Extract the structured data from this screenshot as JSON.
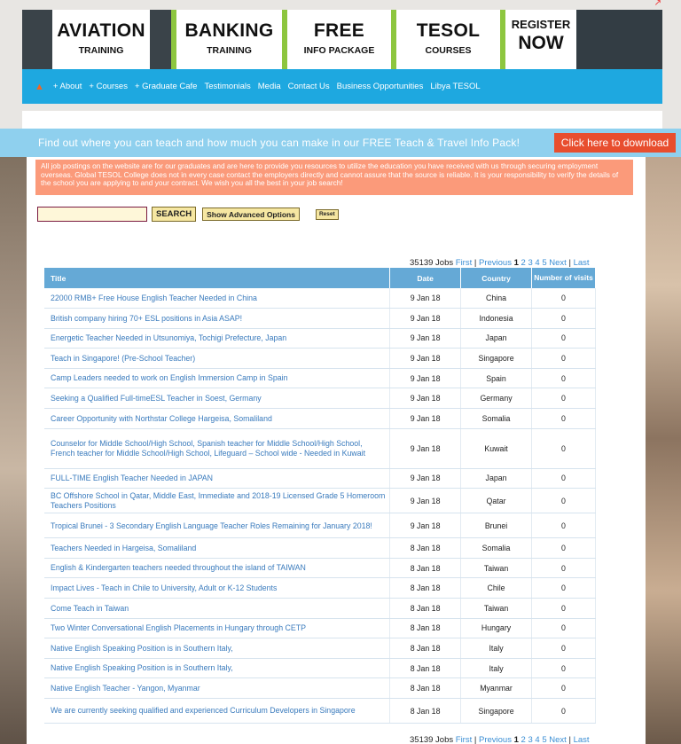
{
  "header": {
    "tiles": [
      {
        "big": "AVIATION",
        "small": "TRAINING"
      },
      {
        "big": "BANKING",
        "small": "TRAINING"
      },
      {
        "big": "FREE",
        "small": "INFO PACKAGE"
      },
      {
        "big": "TESOL",
        "small": "COURSES"
      }
    ],
    "register": {
      "line1": "REGISTER",
      "line2": "NOW"
    }
  },
  "nav": {
    "items": [
      "+ About",
      "+ Courses",
      "+ Graduate Cafe",
      "Testimonials",
      "Media",
      "Contact Us",
      "Business Opportunities",
      "Libya TESOL"
    ]
  },
  "promo": {
    "text": "Find out where you can teach and how much you can make in our FREE Teach & Travel Info Pack!",
    "button": "Click here to download"
  },
  "notice": "All job postings on the website are for our graduates and are here to provide you resources to utilize the education you have received with us through securing employment overseas. Global TESOL College does not in every case contact the employers directly and cannot assure that the source is reliable. It is your responsibility to verify the details of the school you are applying to and your contract. We wish you all the best in your job search!",
  "search": {
    "value": "",
    "search_label": "SEARCH",
    "advanced_label": "Show Advanced Options",
    "reset_label": "Reset"
  },
  "pager": {
    "count_text": "35139 Jobs",
    "first": "First",
    "previous": "Previous",
    "current": "1",
    "pages": [
      "2",
      "3",
      "4",
      "5"
    ],
    "next": "Next",
    "last": "Last",
    "sep": "|"
  },
  "table": {
    "headers": {
      "title": "Title",
      "date": "Date",
      "country": "Country",
      "visits": "Number of visits"
    },
    "rows": [
      {
        "title": "22000 RMB+ Free House English Teacher Needed in China",
        "date": "9 Jan 18",
        "country": "China",
        "visits": "0"
      },
      {
        "title": "British company hiring 70+ ESL positions in Asia ASAP!",
        "date": "9 Jan 18",
        "country": "Indonesia",
        "visits": "0"
      },
      {
        "title": "Energetic Teacher Needed in Utsunomiya, Tochigi Prefecture, Japan",
        "date": "9 Jan 18",
        "country": "Japan",
        "visits": "0"
      },
      {
        "title": "Teach in Singapore! (Pre-School Teacher)",
        "date": "9 Jan 18",
        "country": "Singapore",
        "visits": "0"
      },
      {
        "title": "Camp Leaders needed to work on English Immersion Camp in Spain",
        "date": "9 Jan 18",
        "country": "Spain",
        "visits": "0"
      },
      {
        "title": "Seeking a Qualified Full-timeESL Teacher in Soest, Germany",
        "date": "9 Jan 18",
        "country": "Germany",
        "visits": "0"
      },
      {
        "title": "Career Opportunity with Northstar College Hargeisa, Somaliland",
        "date": "9 Jan 18",
        "country": "Somalia",
        "visits": "0"
      },
      {
        "title": "Counselor for Middle School/High School, Spanish teacher for Middle School/High School, French teacher for Middle School/High School, Lifeguard – School wide - Needed in Kuwait",
        "date": "9 Jan 18",
        "country": "Kuwait",
        "visits": "0"
      },
      {
        "title": "FULL-TIME English Teacher Needed in JAPAN",
        "date": "9 Jan 18",
        "country": "Japan",
        "visits": "0"
      },
      {
        "title": "BC Offshore School in Qatar, Middle East, Immediate and 2018-19 Licensed Grade 5 Homeroom Teachers Positions",
        "date": "9 Jan 18",
        "country": "Qatar",
        "visits": "0"
      },
      {
        "title": "Tropical Brunei - 3 Secondary English Language Teacher Roles Remaining for January 2018!",
        "date": "9 Jan 18",
        "country": "Brunei",
        "visits": "0"
      },
      {
        "title": "Teachers Needed in Hargeisa, Somaliland",
        "date": "8 Jan 18",
        "country": "Somalia",
        "visits": "0"
      },
      {
        "title": "English & Kindergarten teachers needed throughout the island of TAIWAN",
        "date": "8 Jan 18",
        "country": "Taiwan",
        "visits": "0"
      },
      {
        "title": "Impact Lives - Teach in Chile to University, Adult or K-12 Students",
        "date": "8 Jan 18",
        "country": "Chile",
        "visits": "0"
      },
      {
        "title": "Come Teach in Taiwan",
        "date": "8 Jan 18",
        "country": "Taiwan",
        "visits": "0"
      },
      {
        "title": "Two Winter Conversational English Placements in Hungary through CETP",
        "date": "8 Jan 18",
        "country": "Hungary",
        "visits": "0"
      },
      {
        "title": "Native English Speaking Position is in Southern Italy,",
        "date": "8 Jan 18",
        "country": "Italy",
        "visits": "0"
      },
      {
        "title": "Native English Speaking Position is in Southern Italy,",
        "date": "8 Jan 18",
        "country": "Italy",
        "visits": "0"
      },
      {
        "title": "Native English Teacher - Yangon, Myanmar",
        "date": "8 Jan 18",
        "country": "Myanmar",
        "visits": "0"
      },
      {
        "title": "We are currently seeking qualified and experienced Curriculum Developers in Singapore",
        "date": "8 Jan 18",
        "country": "Singapore",
        "visits": "0"
      }
    ]
  }
}
